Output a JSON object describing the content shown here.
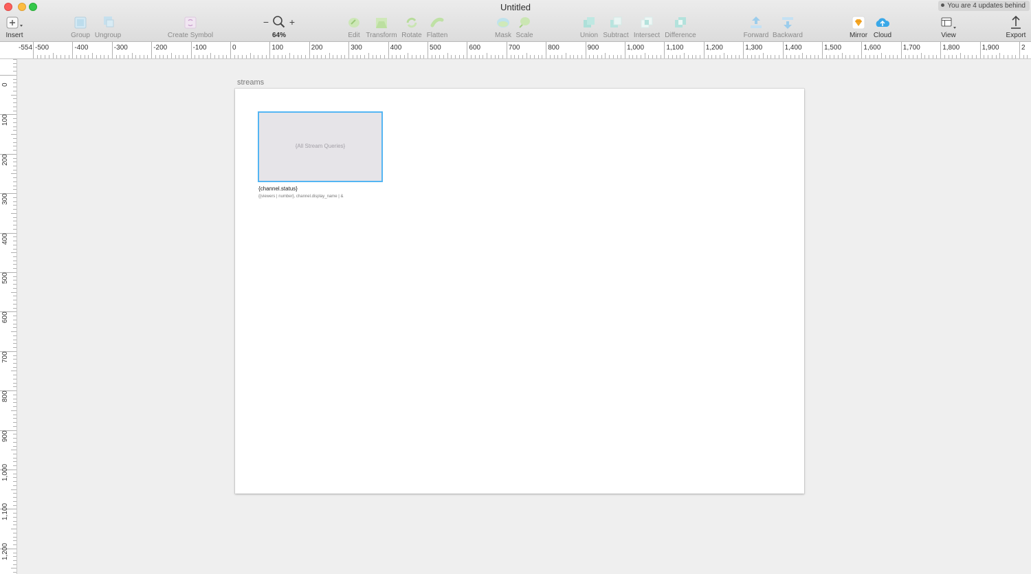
{
  "window": {
    "title": "Untitled",
    "update_notice": "You are 4 updates behind"
  },
  "toolbar": {
    "insert": "Insert",
    "group": "Group",
    "ungroup": "Ungroup",
    "create_symbol": "Create Symbol",
    "zoom_out": "−",
    "zoom_in": "+",
    "zoom_level": "64%",
    "edit": "Edit",
    "transform": "Transform",
    "rotate": "Rotate",
    "flatten": "Flatten",
    "mask": "Mask",
    "scale": "Scale",
    "union": "Union",
    "subtract": "Subtract",
    "intersect": "Intersect",
    "difference": "Difference",
    "forward": "Forward",
    "backward": "Backward",
    "mirror": "Mirror",
    "cloud": "Cloud",
    "view": "View",
    "export": "Export"
  },
  "rulers": {
    "horizontal": [
      "-554",
      "-500",
      "-400",
      "-300",
      "-200",
      "-100",
      "0",
      "100",
      "200",
      "300",
      "400",
      "500",
      "600",
      "700",
      "800",
      "900",
      "1,000",
      "1,100",
      "1,200",
      "1,300",
      "1,400",
      "1,500",
      "1,600",
      "1,700",
      "1,800",
      "1,900",
      "2"
    ],
    "vertical": [
      "0",
      "100",
      "200",
      "300",
      "400",
      "500",
      "600",
      "700",
      "800",
      "900",
      "1,000",
      "1,100",
      "1,200"
    ]
  },
  "artboard": {
    "name": "streams",
    "card_placeholder": "{All Stream Queries}",
    "status_text": "{channel.status}",
    "meta_text": "{{viewers | number}, channel.display_name | &"
  },
  "colors": {
    "selection": "#53b5f3",
    "accent_blue": "#3aa8e8",
    "mirror_gold": "#f5a623"
  }
}
